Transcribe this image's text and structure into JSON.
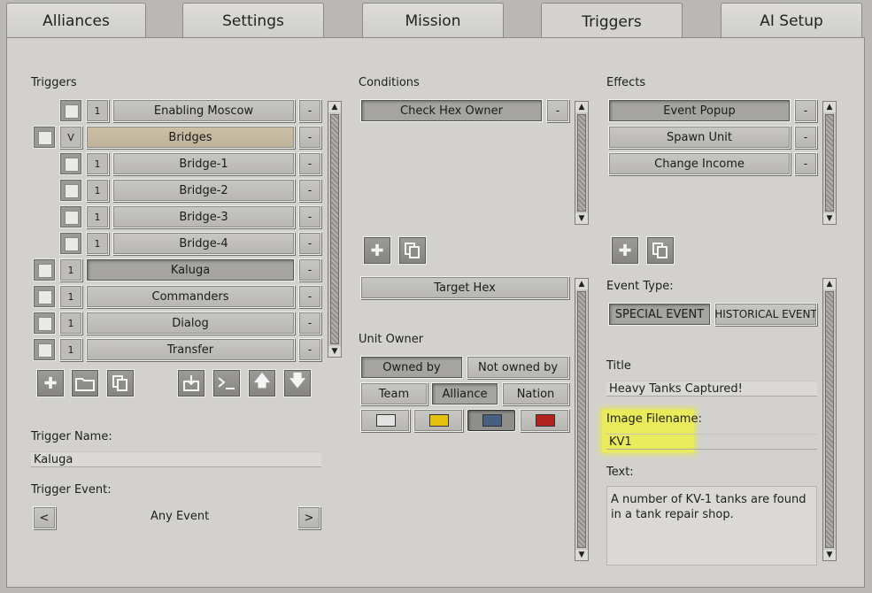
{
  "tabs": [
    {
      "label": "Alliances",
      "active": false
    },
    {
      "label": "Settings",
      "active": false
    },
    {
      "label": "Mission",
      "active": false
    },
    {
      "label": "Triggers",
      "active": true
    },
    {
      "label": "AI Setup",
      "active": false
    }
  ],
  "triggers": {
    "heading": "Triggers",
    "items": [
      {
        "label": "Enabling Moscow",
        "count": "1",
        "indent": true,
        "highlight": false,
        "selected": false
      },
      {
        "label": "Bridges",
        "count": "V",
        "indent": false,
        "highlight": true,
        "selected": false
      },
      {
        "label": "Bridge-1",
        "count": "1",
        "indent": true,
        "highlight": false,
        "selected": false
      },
      {
        "label": "Bridge-2",
        "count": "1",
        "indent": true,
        "highlight": false,
        "selected": false
      },
      {
        "label": "Bridge-3",
        "count": "1",
        "indent": true,
        "highlight": false,
        "selected": false
      },
      {
        "label": "Bridge-4",
        "count": "1",
        "indent": true,
        "highlight": false,
        "selected": false
      },
      {
        "label": "Kaluga",
        "count": "1",
        "indent": false,
        "highlight": false,
        "selected": true
      },
      {
        "label": "Commanders",
        "count": "1",
        "indent": false,
        "highlight": false,
        "selected": false
      },
      {
        "label": "Dialog",
        "count": "1",
        "indent": false,
        "highlight": false,
        "selected": false
      },
      {
        "label": "Transfer",
        "count": "1",
        "indent": false,
        "highlight": false,
        "selected": false
      }
    ],
    "remove_label": "-",
    "toolbar_icons": [
      "add-icon",
      "folder-icon",
      "copy-icon",
      "import-icon",
      "console-icon",
      "move-up-icon",
      "move-down-icon"
    ],
    "name_label": "Trigger Name:",
    "name_value": "Kaluga",
    "event_label": "Trigger Event:",
    "event_value": "Any Event",
    "prev_label": "<",
    "next_label": ">"
  },
  "conditions": {
    "heading": "Conditions",
    "items": [
      {
        "label": "Check Hex Owner"
      }
    ],
    "remove_label": "-",
    "target_hex_label": "Target Hex",
    "unit_owner_label": "Unit Owner",
    "owned_by_label": "Owned by",
    "not_owned_by_label": "Not owned by",
    "team_label": "Team",
    "alliance_label": "Alliance",
    "nation_label": "Nation",
    "swatches": [
      {
        "color": "#e2e2e2",
        "selected": false
      },
      {
        "color": "#e6c20f",
        "selected": false
      },
      {
        "color": "#46607f",
        "selected": true
      },
      {
        "color": "#b32420",
        "selected": false
      }
    ]
  },
  "effects": {
    "heading": "Effects",
    "items": [
      {
        "label": "Event Popup"
      },
      {
        "label": "Spawn Unit"
      },
      {
        "label": "Change Income"
      }
    ],
    "remove_label": "-",
    "event_type_label": "Event Type:",
    "special_event_label": "SPECIAL EVENT",
    "historical_event_label": "HISTORICAL EVENT",
    "title_label": "Title",
    "title_value": "Heavy Tanks Captured!",
    "image_label": "Image Filename:",
    "image_value": "KV1",
    "text_label": "Text:",
    "text_value": "A number of KV-1 tanks are found in a tank repair shop."
  }
}
